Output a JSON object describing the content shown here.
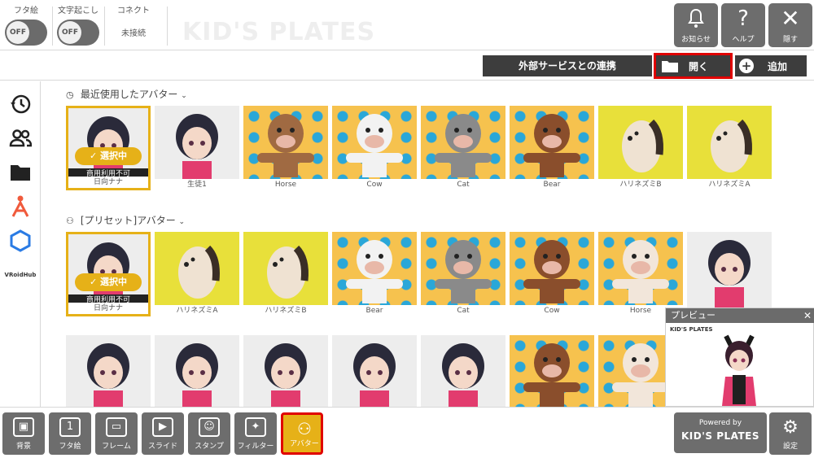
{
  "toggles": [
    {
      "label": "フタ絵",
      "state": "OFF"
    },
    {
      "label": "文字起こし",
      "state": "OFF"
    }
  ],
  "connect": {
    "label": "コネクト",
    "status": "未接続"
  },
  "brand_watermark": "KID'S PLATES",
  "top_buttons": [
    {
      "icon": "bell-icon",
      "label": "お知らせ"
    },
    {
      "icon": "help-icon",
      "label": "ヘルプ"
    },
    {
      "icon": "close-icon",
      "label": "隠す"
    }
  ],
  "actions": {
    "external": "外部サービスとの連携",
    "open": "開く",
    "add": "追加"
  },
  "sidebar": [
    {
      "icon": "history-icon"
    },
    {
      "icon": "people-icon"
    },
    {
      "icon": "folder-icon"
    },
    {
      "icon": "person-a-icon"
    },
    {
      "icon": "hexagon-icon"
    },
    {
      "icon": "vroidhub-logo",
      "text": "VRoidHub"
    }
  ],
  "sections": {
    "recent": "最近使用したアバター",
    "preset": "[プリセット]アバター"
  },
  "recent_avatars": [
    {
      "name": "日向ナナ",
      "bg": "gray",
      "selected": true,
      "badge": "選択中",
      "note": "商用利用不可"
    },
    {
      "name": "生徒1",
      "bg": "gray"
    },
    {
      "name": "Horse",
      "bg": "pattern"
    },
    {
      "name": "Cow",
      "bg": "pattern"
    },
    {
      "name": "Cat",
      "bg": "pattern"
    },
    {
      "name": "Bear",
      "bg": "pattern"
    },
    {
      "name": "ハリネズミB",
      "bg": "yellow"
    },
    {
      "name": "ハリネズミA",
      "bg": "yellow"
    }
  ],
  "preset_avatars": [
    {
      "name": "日向ナナ",
      "bg": "gray",
      "selected": true,
      "badge": "選択中",
      "note": "商用利用不可"
    },
    {
      "name": "ハリネズミA",
      "bg": "yellow"
    },
    {
      "name": "ハリネズミB",
      "bg": "yellow"
    },
    {
      "name": "Bear",
      "bg": "pattern"
    },
    {
      "name": "Cat",
      "bg": "pattern"
    },
    {
      "name": "Cow",
      "bg": "pattern"
    },
    {
      "name": "Horse",
      "bg": "pattern"
    },
    {
      "name": "",
      "bg": "gray"
    }
  ],
  "third_row": [
    {
      "name": "",
      "bg": "gray"
    },
    {
      "name": "",
      "bg": "gray"
    },
    {
      "name": "",
      "bg": "gray"
    },
    {
      "name": "",
      "bg": "gray"
    },
    {
      "name": "",
      "bg": "gray"
    },
    {
      "name": "",
      "bg": "pattern"
    },
    {
      "name": "",
      "bg": "pattern"
    }
  ],
  "preview": {
    "title": "プレビュー",
    "logo": "KID'S PLATES"
  },
  "bottom_tools": [
    {
      "icon": "image-icon",
      "label": "背景"
    },
    {
      "icon": "cover-icon",
      "label": "フタ絵"
    },
    {
      "icon": "frame-icon",
      "label": "フレーム"
    },
    {
      "icon": "slide-icon",
      "label": "スライド"
    },
    {
      "icon": "stamp-icon",
      "label": "スタンプ"
    },
    {
      "icon": "filter-icon",
      "label": "フィルター"
    },
    {
      "icon": "avatar-icon",
      "label": "アバター",
      "active": true
    }
  ],
  "powered_by": {
    "line1": "Powered by",
    "line2": "KID'S PLATES"
  },
  "settings": {
    "label": "設定"
  },
  "colors": {
    "accent": "#e6b118",
    "highlight": "#e00000",
    "button_gray": "#6d6d6d",
    "dark": "#3d3d3d"
  }
}
